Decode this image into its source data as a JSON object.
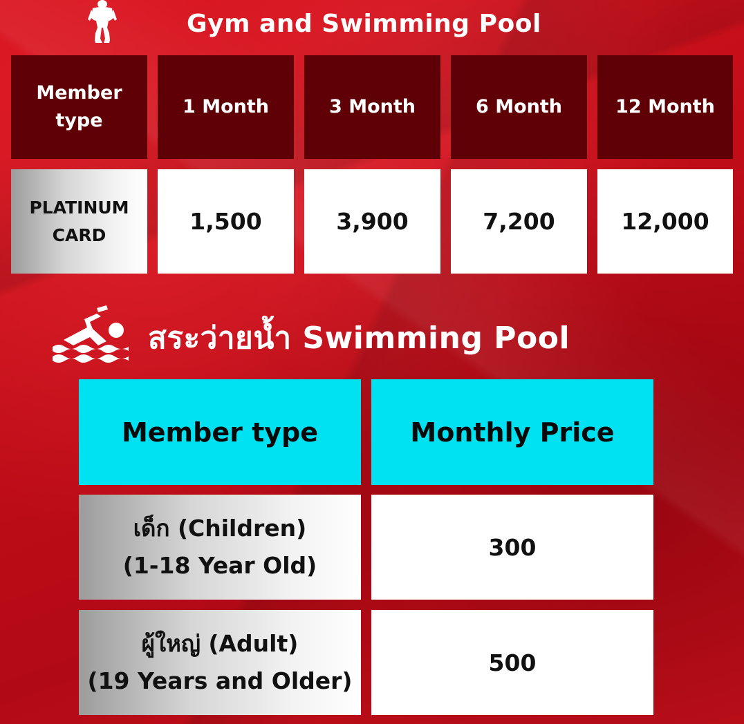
{
  "gym": {
    "title": "Gym and Swimming Pool",
    "icon": "bodybuilder-icon",
    "table": {
      "headers": [
        "Member\ntype",
        "1 Month",
        "3 Month",
        "6 Month",
        "12 Month"
      ],
      "rows": [
        {
          "member_type": "PLATINUM\nCARD",
          "prices": [
            "1,500",
            "3,900",
            "7,200",
            "12,000"
          ]
        }
      ]
    }
  },
  "pool": {
    "title": "สระว่ายน้ำ Swimming Pool",
    "icon": "swimmer-icon",
    "table": {
      "headers": [
        "Member type",
        "Monthly Price"
      ],
      "rows": [
        {
          "member_type": "เด็ก (Children)\n(1-18 Year Old)",
          "price": "300"
        },
        {
          "member_type": "ผู้ใหญ่ (Adult)\n(19 Years and Older)",
          "price": "500"
        }
      ]
    }
  },
  "colors": {
    "background": "#c10d18",
    "header_dark": "#5e0005",
    "header_cyan": "#00e1f2",
    "cell_white": "#ffffff"
  }
}
